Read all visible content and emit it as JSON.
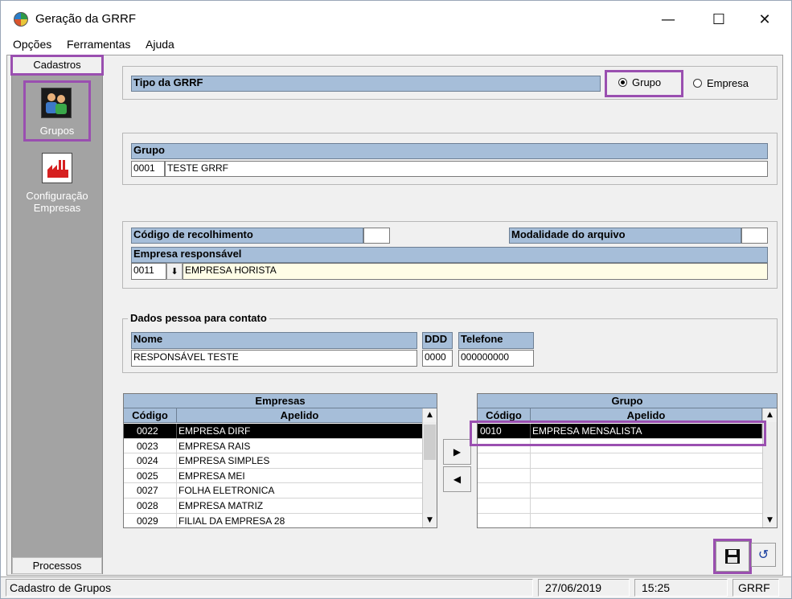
{
  "window": {
    "title": "Geração da GRRF"
  },
  "menu": [
    "Opções",
    "Ferramentas",
    "Ajuda"
  ],
  "sidebar": {
    "header": "Cadastros",
    "items": [
      {
        "label": "Grupos",
        "icon": "users-icon"
      },
      {
        "label": "Configuração\nEmpresas",
        "icon": "factory-icon"
      }
    ],
    "footer": "Processos"
  },
  "tipo": {
    "label": "Tipo da GRRF",
    "options": [
      "Grupo",
      "Empresa"
    ],
    "selected": "Grupo"
  },
  "grupo": {
    "label": "Grupo",
    "code": "0001",
    "name": "TESTE GRRF"
  },
  "recolhimento": {
    "codigo_label": "Código de recolhimento",
    "codigo_value": "",
    "modalidade_label": "Modalidade do arquivo",
    "modalidade_value": "",
    "empresa_label": "Empresa responsável",
    "empresa_code": "0011",
    "empresa_name": "EMPRESA HORISTA"
  },
  "contato": {
    "title": "Dados pessoa para contato",
    "nome_label": "Nome",
    "ddd_label": "DDD",
    "telefone_label": "Telefone",
    "nome": "RESPONSÁVEL TESTE",
    "ddd": "0000",
    "telefone": "000000000"
  },
  "empresas_grid": {
    "caption": "Empresas",
    "columns": [
      "Código",
      "Apelido"
    ],
    "rows": [
      [
        "0022",
        "EMPRESA DIRF"
      ],
      [
        "0023",
        "EMPRESA RAIS"
      ],
      [
        "0024",
        "EMPRESA SIMPLES"
      ],
      [
        "0025",
        "EMPRESA MEI"
      ],
      [
        "0027",
        "FOLHA ELETRONICA"
      ],
      [
        "0028",
        "EMPRESA MATRIZ"
      ],
      [
        "0029",
        "FILIAL DA EMPRESA 28"
      ]
    ],
    "selected_index": 0
  },
  "grupo_grid": {
    "caption": "Grupo",
    "columns": [
      "Código",
      "Apelido"
    ],
    "rows": [
      [
        "0010",
        "EMPRESA MENSALISTA"
      ]
    ],
    "selected_index": 0
  },
  "statusbar": {
    "message": "Cadastro de Grupos",
    "date": "27/06/2019",
    "time": "15:25",
    "module": "GRRF"
  },
  "colors": {
    "header_blue": "#a6bed9",
    "highlight": "#9a4fb0",
    "sidebar_gray": "#a3a3a3"
  }
}
